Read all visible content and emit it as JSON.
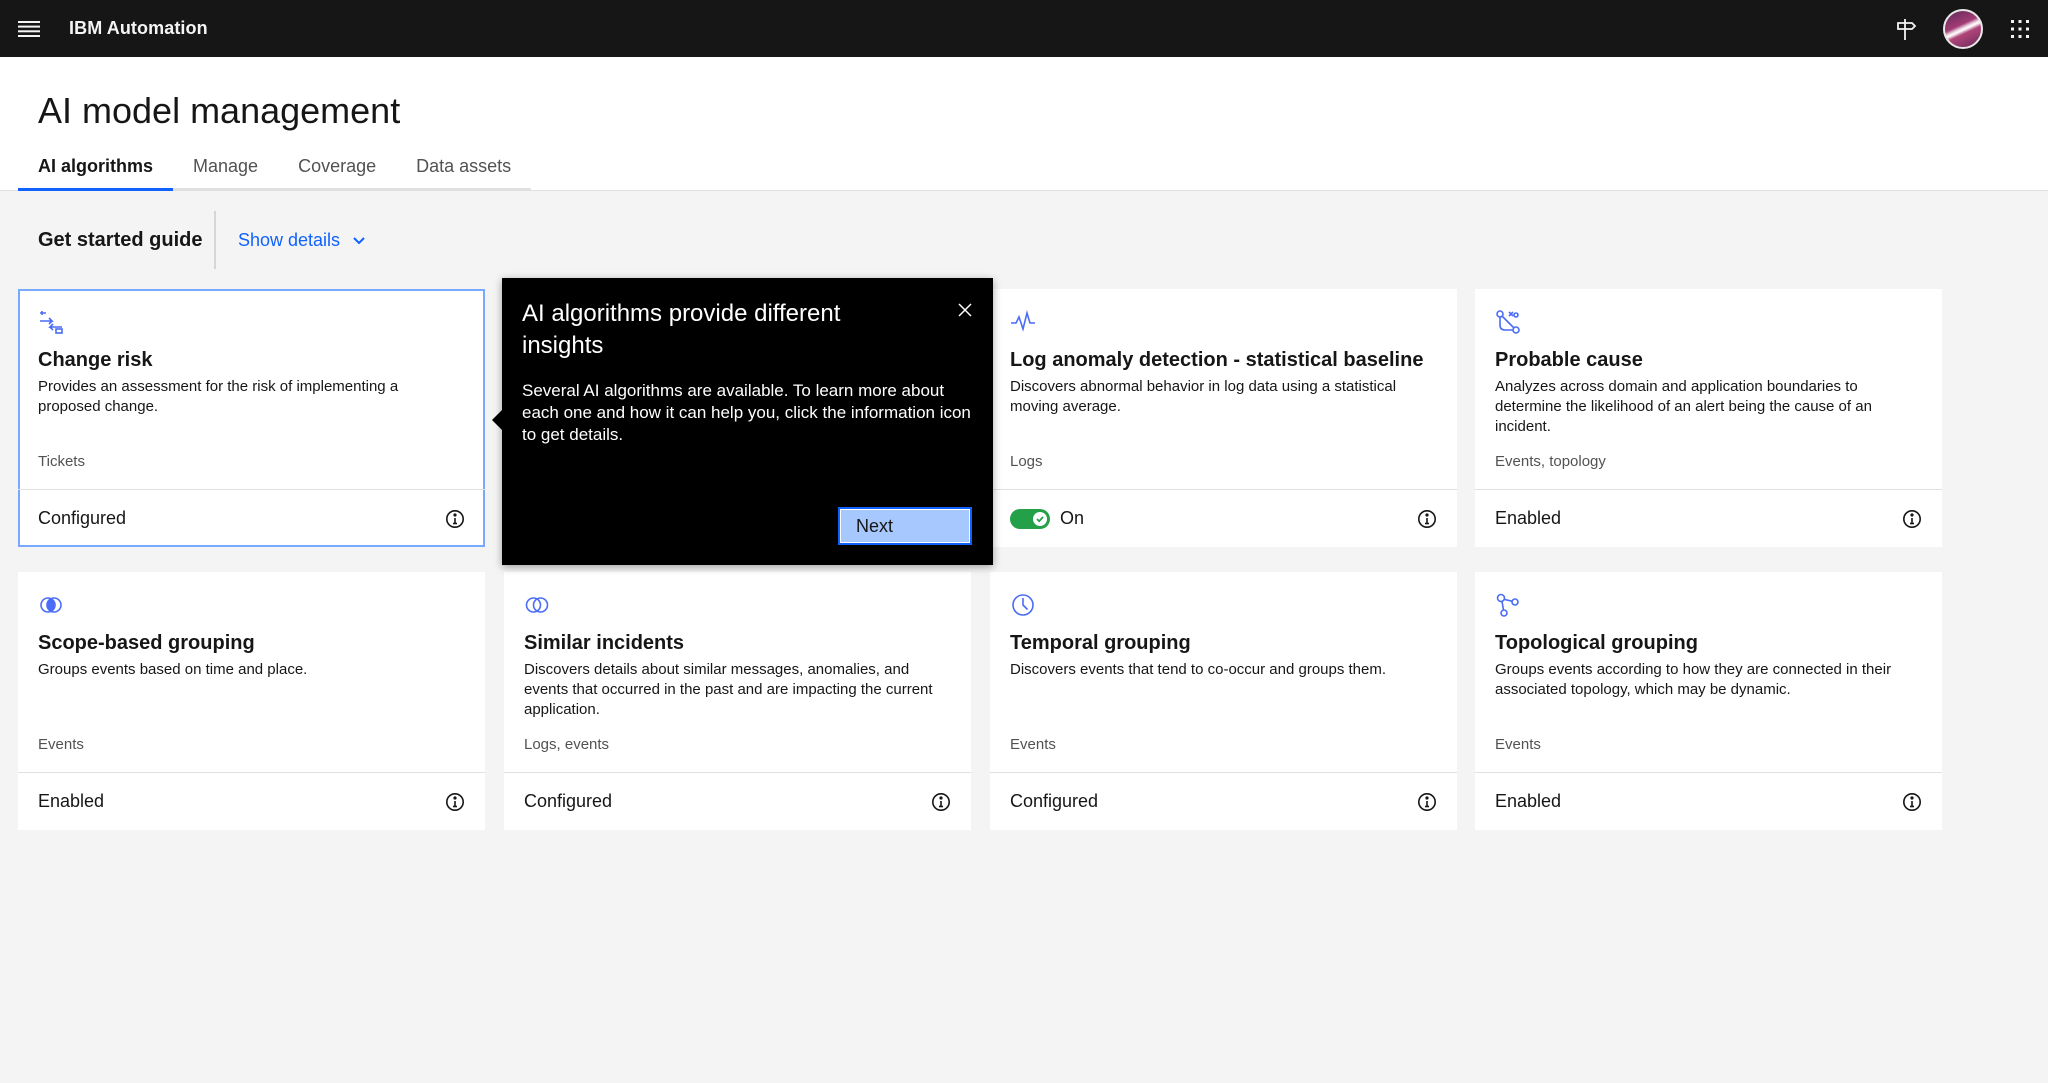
{
  "header": {
    "brand": "IBM Automation",
    "icons": {
      "menu": "menu-icon",
      "guide": "signpost-icon",
      "avatar": "user-avatar",
      "apps": "app-switcher-icon"
    }
  },
  "page": {
    "title": "AI model management",
    "tabs": [
      {
        "label": "AI algorithms",
        "active": true
      },
      {
        "label": "Manage",
        "active": false
      },
      {
        "label": "Coverage",
        "active": false
      },
      {
        "label": "Data assets",
        "active": false
      }
    ]
  },
  "guide": {
    "label": "Get started guide",
    "show_details": "Show details"
  },
  "cards": [
    {
      "title": "Change risk",
      "description": "Provides an assessment for the risk of implementing a proposed change.",
      "tags": "Tickets",
      "status": "Configured",
      "icon": "change-risk-icon"
    },
    {
      "title": "Log anomaly detection - statistical baseline",
      "description": "Discovers abnormal behavior in log data using a statistical moving average.",
      "tags": "Logs",
      "status": "On",
      "toggle_on": true,
      "icon": "activity-icon"
    },
    {
      "title": "Probable cause",
      "description": "Analyzes across domain and application boundaries to determine the likelihood of an alert being the cause of an incident.",
      "tags": "Events, topology",
      "status": "Enabled",
      "icon": "probable-cause-icon"
    },
    {
      "title": "Scope-based grouping",
      "description": "Groups events based on time and place.",
      "tags": "Events",
      "status": "Enabled",
      "icon": "scope-grouping-icon"
    },
    {
      "title": "Similar incidents",
      "description": "Discovers details about similar messages, anomalies, and events that occurred in the past and are impacting the current application.",
      "tags": "Logs, events",
      "status": "Configured",
      "icon": "similar-incidents-icon"
    },
    {
      "title": "Temporal grouping",
      "description": "Discovers events that tend to co-occur and groups them.",
      "tags": "Events",
      "status": "Configured",
      "icon": "clock-icon"
    },
    {
      "title": "Topological grouping",
      "description": "Groups events according to how they are connected in their associated topology, which may be dynamic.",
      "tags": "Events",
      "status": "Enabled",
      "icon": "topology-icon"
    }
  ],
  "tooltip": {
    "title": "AI algorithms provide different insights",
    "body": "Several AI algorithms are available. To learn more about each one and how it can help you, click the information icon to get details.",
    "next_label": "Next"
  },
  "colors": {
    "accent": "#0f62fe",
    "header_bg": "#161616",
    "toggle_on": "#24a148",
    "icon_blue": "#4a6cf7"
  }
}
